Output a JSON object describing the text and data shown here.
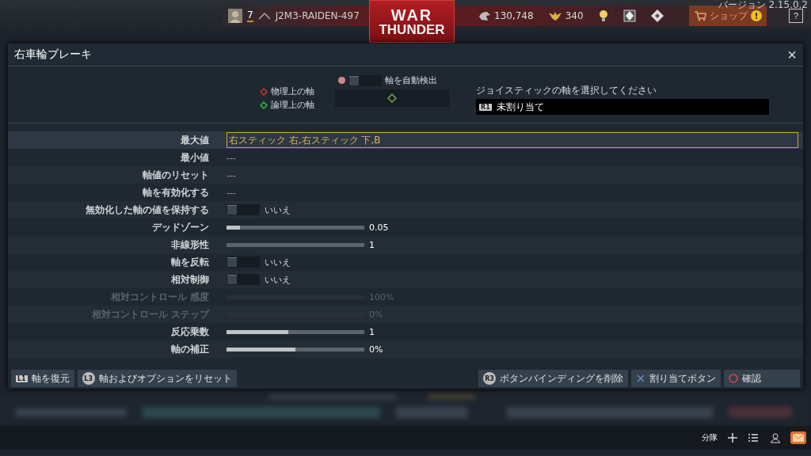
{
  "version": "バージョン 2.15.0.2",
  "top_bar": {
    "level": "7",
    "nickname": "J2M3-RAIDEN-497",
    "logo": [
      "WAR",
      "THUNDER"
    ],
    "silver": "130,748",
    "gold": "340",
    "shop": "ショップ",
    "shop_badge": "!",
    "help": "?"
  },
  "dialog": {
    "title": "右車輪ブレーキ",
    "close": "×",
    "axis": {
      "legend": [
        {
          "label": "物理上の軸",
          "color": "#d03030"
        },
        {
          "label": "論理上の軸",
          "color": "#30c040"
        }
      ],
      "auto_detect": {
        "label": "軸を自動検出",
        "on": false
      },
      "prompt": "ジョイスティックの軸を選択してください",
      "button_badge": "R1",
      "assigned": "未割り当て"
    },
    "rows": [
      {
        "label": "最大値",
        "kind": "text",
        "value": "右スティック 右,右スティック 下,B",
        "selected": true,
        "disabled": false
      },
      {
        "label": "最小値",
        "kind": "text",
        "value": "---",
        "selected": false,
        "disabled": false
      },
      {
        "label": "軸値のリセット",
        "kind": "text",
        "value": "---",
        "selected": false,
        "disabled": false
      },
      {
        "label": "軸を有効化する",
        "kind": "text",
        "value": "---",
        "selected": false,
        "disabled": false
      },
      {
        "label": "無効化した軸の値を保持する",
        "kind": "toggle",
        "on": false,
        "value": "いいえ",
        "selected": false,
        "disabled": false
      },
      {
        "label": "デッドゾーン",
        "kind": "slider",
        "level": 0.1,
        "value": "0.05",
        "selected": false,
        "disabled": false
      },
      {
        "label": "非線形性",
        "kind": "slider",
        "value": "1",
        "selected": false,
        "disabled": false
      },
      {
        "label": "軸を反転",
        "kind": "toggle",
        "on": false,
        "value": "いいえ",
        "selected": false,
        "disabled": false
      },
      {
        "label": "相対制御",
        "kind": "toggle",
        "on": false,
        "value": "いいえ",
        "selected": false,
        "disabled": false
      },
      {
        "label": "相対コントロール 感度",
        "kind": "slider",
        "value": "100%",
        "selected": false,
        "disabled": true
      },
      {
        "label": "相対コントロール ステップ",
        "kind": "slider",
        "value": "0%",
        "selected": false,
        "disabled": true
      },
      {
        "label": "反応乗数",
        "kind": "slider",
        "level": 0.45,
        "value": "1",
        "selected": false,
        "disabled": false
      },
      {
        "label": "軸の補正",
        "kind": "slider",
        "level": 0.5,
        "value": "0%",
        "selected": false,
        "disabled": false
      }
    ],
    "footer_left": [
      {
        "badge": "L1",
        "label": "軸を復元"
      },
      {
        "badge": "L3",
        "label": "軸およびオプションをリセット"
      }
    ],
    "footer_right": [
      {
        "badge": "R3",
        "label": "ボタンバインディングを削除"
      },
      {
        "kind": "cross",
        "label": "割り当てボタン"
      },
      {
        "kind": "circle",
        "label": "確認"
      }
    ]
  },
  "bottom_bar": {
    "squad": "分隊"
  }
}
